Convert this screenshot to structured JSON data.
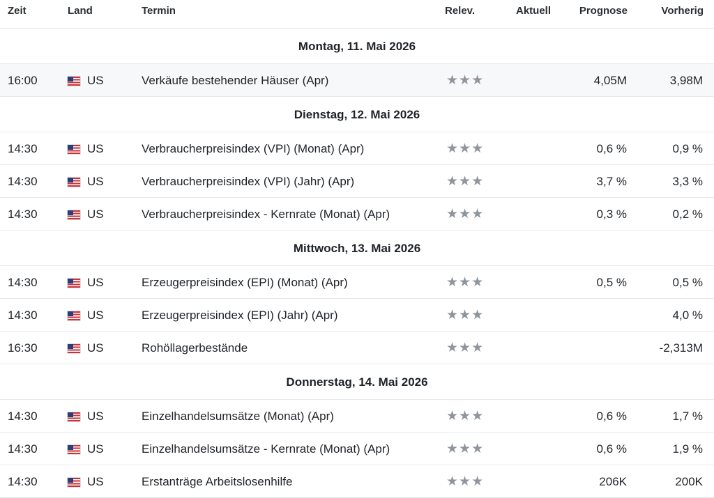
{
  "headers": {
    "zeit": "Zeit",
    "land": "Land",
    "termin": "Termin",
    "relev": "Relev.",
    "aktuell": "Aktuell",
    "prognose": "Prognose",
    "vorherig": "Vorherig"
  },
  "groups": [
    {
      "date": "Montag, 11. Mai 2026",
      "rows": [
        {
          "time": "16:00",
          "country": "US",
          "event": "Verkäufe bestehender Häuser  (Apr)",
          "relevance": "★★★",
          "actual": "",
          "forecast": "4,05M",
          "previous": "3,98M"
        }
      ]
    },
    {
      "date": "Dienstag, 12. Mai 2026",
      "rows": [
        {
          "time": "14:30",
          "country": "US",
          "event": "Verbraucherpreisindex (VPI) (Monat) (Apr)",
          "relevance": "★★★",
          "actual": "",
          "forecast": "0,6 %",
          "previous": "0,9 %"
        },
        {
          "time": "14:30",
          "country": "US",
          "event": "Verbraucherpreisindex (VPI) (Jahr) (Apr)",
          "relevance": "★★★",
          "actual": "",
          "forecast": "3,7 %",
          "previous": "3,3 %"
        },
        {
          "time": "14:30",
          "country": "US",
          "event": "Verbraucherpreisindex - Kernrate (Monat) (Apr)",
          "relevance": "★★★",
          "actual": "",
          "forecast": "0,3 %",
          "previous": "0,2 %"
        }
      ]
    },
    {
      "date": "Mittwoch, 13. Mai 2026",
      "rows": [
        {
          "time": "14:30",
          "country": "US",
          "event": "Erzeugerpreisindex (EPI) (Monat) (Apr)",
          "relevance": "★★★",
          "actual": "",
          "forecast": "0,5 %",
          "previous": "0,5 %"
        },
        {
          "time": "14:30",
          "country": "US",
          "event": "Erzeugerpreisindex (EPI) (Jahr) (Apr)",
          "relevance": "★★★",
          "actual": "",
          "forecast": "",
          "previous": "4,0 %"
        },
        {
          "time": "16:30",
          "country": "US",
          "event": "Rohöllagerbestände",
          "relevance": "★★★",
          "actual": "",
          "forecast": "",
          "previous": "-2,313M"
        }
      ]
    },
    {
      "date": "Donnerstag, 14. Mai 2026",
      "rows": [
        {
          "time": "14:30",
          "country": "US",
          "event": "Einzelhandelsumsätze (Monat) (Apr)",
          "relevance": "★★★",
          "actual": "",
          "forecast": "0,6 %",
          "previous": "1,7 %"
        },
        {
          "time": "14:30",
          "country": "US",
          "event": "Einzelhandelsumsätze - Kernrate (Monat) (Apr)",
          "relevance": "★★★",
          "actual": "",
          "forecast": "0,6 %",
          "previous": "1,9 %"
        },
        {
          "time": "14:30",
          "country": "US",
          "event": "Erstanträge Arbeitslosenhilfe",
          "relevance": "★★★",
          "actual": "",
          "forecast": "206K",
          "previous": "200K"
        }
      ]
    }
  ]
}
